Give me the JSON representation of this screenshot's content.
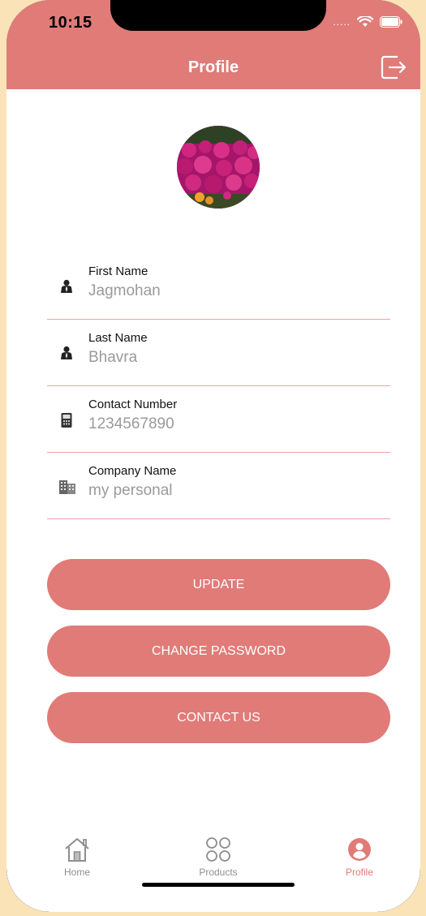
{
  "status_bar": {
    "time": "10:15",
    "signal_dots": "....."
  },
  "header": {
    "title": "Profile",
    "logout_icon": "logout-icon"
  },
  "colors": {
    "accent": "#e07b78",
    "divider": "#e9a3a1",
    "value_text": "#9a9a9a"
  },
  "fields": [
    {
      "label": "First Name",
      "value": "Jagmohan",
      "icon": "person-icon"
    },
    {
      "label": "Last Name",
      "value": "Bhavra",
      "icon": "person-icon"
    },
    {
      "label": "Contact Number",
      "value": "1234567890",
      "icon": "phone-icon"
    },
    {
      "label": "Company Name",
      "value": "my personal",
      "icon": "building-icon"
    }
  ],
  "buttons": {
    "update": "UPDATE",
    "change_password": "CHANGE PASSWORD",
    "contact_us": "CONTACT US"
  },
  "tabs": [
    {
      "label": "Home",
      "icon": "home-icon",
      "active": false
    },
    {
      "label": "Products",
      "icon": "grid-icon",
      "active": false
    },
    {
      "label": "Profile",
      "icon": "profile-icon",
      "active": true
    }
  ]
}
